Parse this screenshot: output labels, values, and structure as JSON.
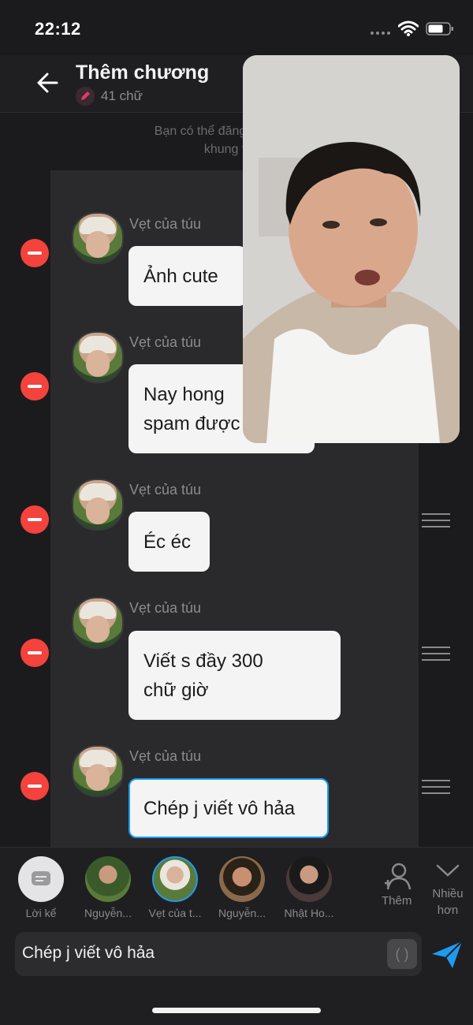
{
  "status_bar": {
    "time": "22:12"
  },
  "header": {
    "title": "Thêm chương",
    "char_count": "41 chữ"
  },
  "info_text": {
    "line1": "Bạn có thể đăng chương khi đạt",
    "line2": "khung thoại từ"
  },
  "messages": [
    {
      "sender": "Vẹt của túu",
      "lines": [
        "Ảnh cute"
      ]
    },
    {
      "sender": "Vẹt của túu",
      "lines": [
        "Nay hong",
        "spam được"
      ]
    },
    {
      "sender": "Vẹt của túu",
      "lines": [
        "Éc éc"
      ]
    },
    {
      "sender": "Vẹt của túu",
      "lines": [
        "Viết s đầy 300",
        "chữ giờ"
      ]
    },
    {
      "sender": "Vẹt của túu",
      "lines": [
        "Chép j viết vô hảa"
      ]
    }
  ],
  "characters": [
    {
      "label": "Lời kể",
      "type": "narration"
    },
    {
      "label": "Nguyễn..."
    },
    {
      "label": "Vẹt của t...",
      "selected": true
    },
    {
      "label": "Nguyễn..."
    },
    {
      "label": "Nhật Ho..."
    }
  ],
  "actions": {
    "add_label": "Thêm",
    "more_label_line1": "Nhiều",
    "more_label_line2": "hơn"
  },
  "composer": {
    "value": "Chép j viết vô hảa",
    "bracket_glyph": "( )"
  },
  "colors": {
    "accent_blue": "#1e9bf0",
    "remove_red": "#f4423c",
    "background": "#1b1b1d"
  },
  "icons": [
    "back-arrow-icon",
    "pencil-icon",
    "wifi-icon",
    "battery-icon",
    "remove-icon",
    "drag-handle-icon",
    "add-person-icon",
    "chevron-down-icon",
    "send-icon",
    "chat-bubble-icon"
  ]
}
